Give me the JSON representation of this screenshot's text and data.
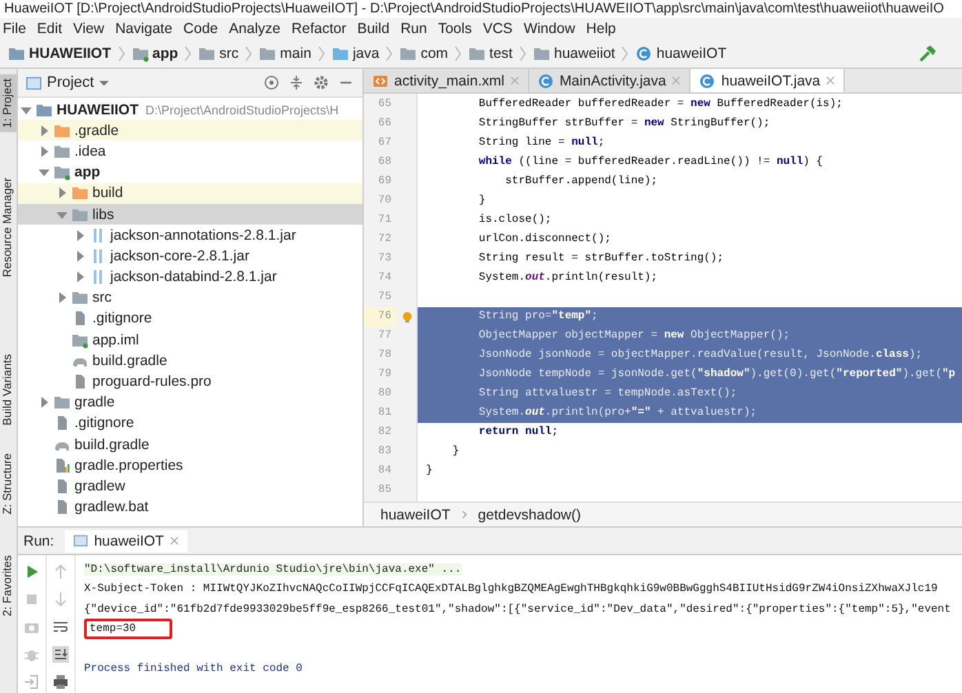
{
  "window": {
    "title": "HuaweiIOT [D:\\Project\\AndroidStudioProjects\\HuaweiIOT] - D:\\Project\\AndroidStudioProjects\\HUAWEIIOT\\app\\src\\main\\java\\com\\test\\huaweiiot\\huaweiIO"
  },
  "menu": [
    "File",
    "Edit",
    "View",
    "Navigate",
    "Code",
    "Analyze",
    "Refactor",
    "Build",
    "Run",
    "Tools",
    "VCS",
    "Window",
    "Help"
  ],
  "breadcrumb": [
    {
      "label": "HUAWEIIOT",
      "kind": "project"
    },
    {
      "label": "app",
      "kind": "module"
    },
    {
      "label": "src",
      "kind": "folder"
    },
    {
      "label": "main",
      "kind": "folder"
    },
    {
      "label": "java",
      "kind": "source"
    },
    {
      "label": "com",
      "kind": "folder"
    },
    {
      "label": "test",
      "kind": "folder"
    },
    {
      "label": "huaweiiot",
      "kind": "folder"
    },
    {
      "label": "huaweiIOT",
      "kind": "class"
    }
  ],
  "side_stripe": [
    {
      "label": "1: Project",
      "selected": true
    },
    {
      "label": "Resource Manager",
      "selected": false
    },
    {
      "label": "Build Variants",
      "selected": false
    },
    {
      "label": "Z: Structure",
      "selected": false
    },
    {
      "label": "2: Favorites",
      "selected": false
    }
  ],
  "project_panel": {
    "title": "Project",
    "tree": [
      {
        "label": "HUAWEIIOT",
        "kind": "project",
        "path": "D:\\Project\\AndroidStudioProjects\\H",
        "expanded": true,
        "selected": false,
        "highlighted": false,
        "children": [
          {
            "label": ".gradle",
            "kind": "folder-orange",
            "expanded": false,
            "selected": false,
            "highlighted": true
          },
          {
            "label": ".idea",
            "kind": "folder",
            "expanded": false,
            "selected": false,
            "highlighted": false
          },
          {
            "label": "app",
            "kind": "module",
            "expanded": true,
            "selected": false,
            "highlighted": false,
            "children": [
              {
                "label": "build",
                "kind": "folder-orange",
                "expanded": false,
                "selected": false,
                "highlighted": true
              },
              {
                "label": "libs",
                "kind": "folder",
                "expanded": true,
                "selected": true,
                "highlighted": false,
                "children": [
                  {
                    "label": "jackson-annotations-2.8.1.jar",
                    "kind": "jar",
                    "expanded": false,
                    "selected": false,
                    "highlighted": false
                  },
                  {
                    "label": "jackson-core-2.8.1.jar",
                    "kind": "jar",
                    "expanded": false,
                    "selected": false,
                    "highlighted": false
                  },
                  {
                    "label": "jackson-databind-2.8.1.jar",
                    "kind": "jar",
                    "expanded": false,
                    "selected": false,
                    "highlighted": false
                  }
                ]
              },
              {
                "label": "src",
                "kind": "folder",
                "expanded": false,
                "selected": false,
                "highlighted": false
              },
              {
                "label": ".gitignore",
                "kind": "file",
                "selected": false,
                "highlighted": false
              },
              {
                "label": "app.iml",
                "kind": "module",
                "selected": false,
                "highlighted": false
              },
              {
                "label": "build.gradle",
                "kind": "gradle",
                "selected": false,
                "highlighted": false
              },
              {
                "label": "proguard-rules.pro",
                "kind": "file",
                "selected": false,
                "highlighted": false
              }
            ]
          },
          {
            "label": "gradle",
            "kind": "folder",
            "expanded": false,
            "selected": false,
            "highlighted": false
          },
          {
            "label": ".gitignore",
            "kind": "file",
            "selected": false,
            "highlighted": false
          },
          {
            "label": "build.gradle",
            "kind": "gradle",
            "selected": false,
            "highlighted": false
          },
          {
            "label": "gradle.properties",
            "kind": "properties",
            "selected": false,
            "highlighted": false
          },
          {
            "label": "gradlew",
            "kind": "file",
            "selected": false,
            "highlighted": false
          },
          {
            "label": "gradlew.bat",
            "kind": "file",
            "selected": false,
            "highlighted": false
          }
        ]
      }
    ]
  },
  "editor": {
    "tabs": [
      {
        "label": "activity_main.xml",
        "kind": "xml",
        "selected": false
      },
      {
        "label": "MainActivity.java",
        "kind": "class",
        "selected": false
      },
      {
        "label": "huaweiIOT.java",
        "kind": "class",
        "selected": true
      }
    ],
    "lines": [
      {
        "number": "65",
        "text": "        BufferedReader bufferedReader = **new** BufferedReader(is);",
        "selected": false
      },
      {
        "number": "66",
        "text": "        StringBuffer strBuffer = **new** StringBuffer();",
        "selected": false
      },
      {
        "number": "67",
        "text": "        String line = **null**;",
        "selected": false
      },
      {
        "number": "68",
        "text": "        **while** ((line = bufferedReader.readLine()) != **null**) {",
        "selected": false
      },
      {
        "number": "69",
        "text": "            strBuffer.append(line);",
        "selected": false
      },
      {
        "number": "70",
        "text": "        }",
        "selected": false
      },
      {
        "number": "71",
        "text": "        is.close();",
        "selected": false
      },
      {
        "number": "72",
        "text": "        urlCon.disconnect();",
        "selected": false
      },
      {
        "number": "73",
        "text": "        String result = strBuffer.toString();",
        "selected": false
      },
      {
        "number": "74",
        "text": "        System.*out*.println(result);",
        "selected": false
      },
      {
        "number": "75",
        "selected": false
      },
      {
        "number": "76",
        "text": "        String pro=**\"temp\"**;",
        "selected": true,
        "bulb": true
      },
      {
        "number": "77",
        "text": "        ObjectMapper objectMapper = **new** ObjectMapper();",
        "selected": true
      },
      {
        "number": "78",
        "text": "        JsonNode jsonNode = objectMapper.readValue(result, JsonNode.**class**);",
        "selected": true
      },
      {
        "number": "79",
        "text": "        JsonNode tempNode = jsonNode.get(**\"shadow\"**).get(0).get(**\"reported\"**).get(**\"p**",
        "selected": true
      },
      {
        "number": "80",
        "text": "        String attvaluestr = tempNode.asText();",
        "selected": true
      },
      {
        "number": "81",
        "text": "        System.*out*.println(pro+**\"=\"** + attvaluestr);",
        "selected": true
      },
      {
        "number": "82",
        "text": "        **return** **null**;",
        "selected": false
      },
      {
        "number": "83",
        "text": "    }",
        "selected": false
      },
      {
        "number": "84",
        "text": "}",
        "selected": false
      },
      {
        "number": "85",
        "selected": false
      }
    ],
    "breadcrumb": [
      "huaweiIOT",
      "getdevshadow()"
    ]
  },
  "run": {
    "label": "Run:",
    "tab": "huaweiIOT",
    "output": [
      {
        "text": "\"D:\\software_install\\Ardunio Studio\\jre\\bin\\java.exe\" ...",
        "kind": "command",
        "boxed": false
      },
      {
        "text": "X-Subject-Token : MIIWtQYJKoZIhvcNAQcCoIIWpjCCFqICAQExDTALBglghkgBZQMEAgEwghTHBgkqhkiG9w0BBwGgghS4BIIUtHsidG9rZW4iOnsiZXhwaXJlc19",
        "kind": "output",
        "boxed": false
      },
      {
        "text": "{\"device_id\":\"61fb2d7fde9933029be5ff9e_esp8266_test01\",\"shadow\":[{\"service_id\":\"Dev_data\",\"desired\":{\"properties\":{\"temp\":5},\"event",
        "kind": "output",
        "boxed": false
      },
      {
        "text": "temp=30",
        "kind": "output",
        "boxed": true
      },
      {
        "text": "Process finished with exit code 0",
        "kind": "exit",
        "boxed": false
      }
    ]
  }
}
